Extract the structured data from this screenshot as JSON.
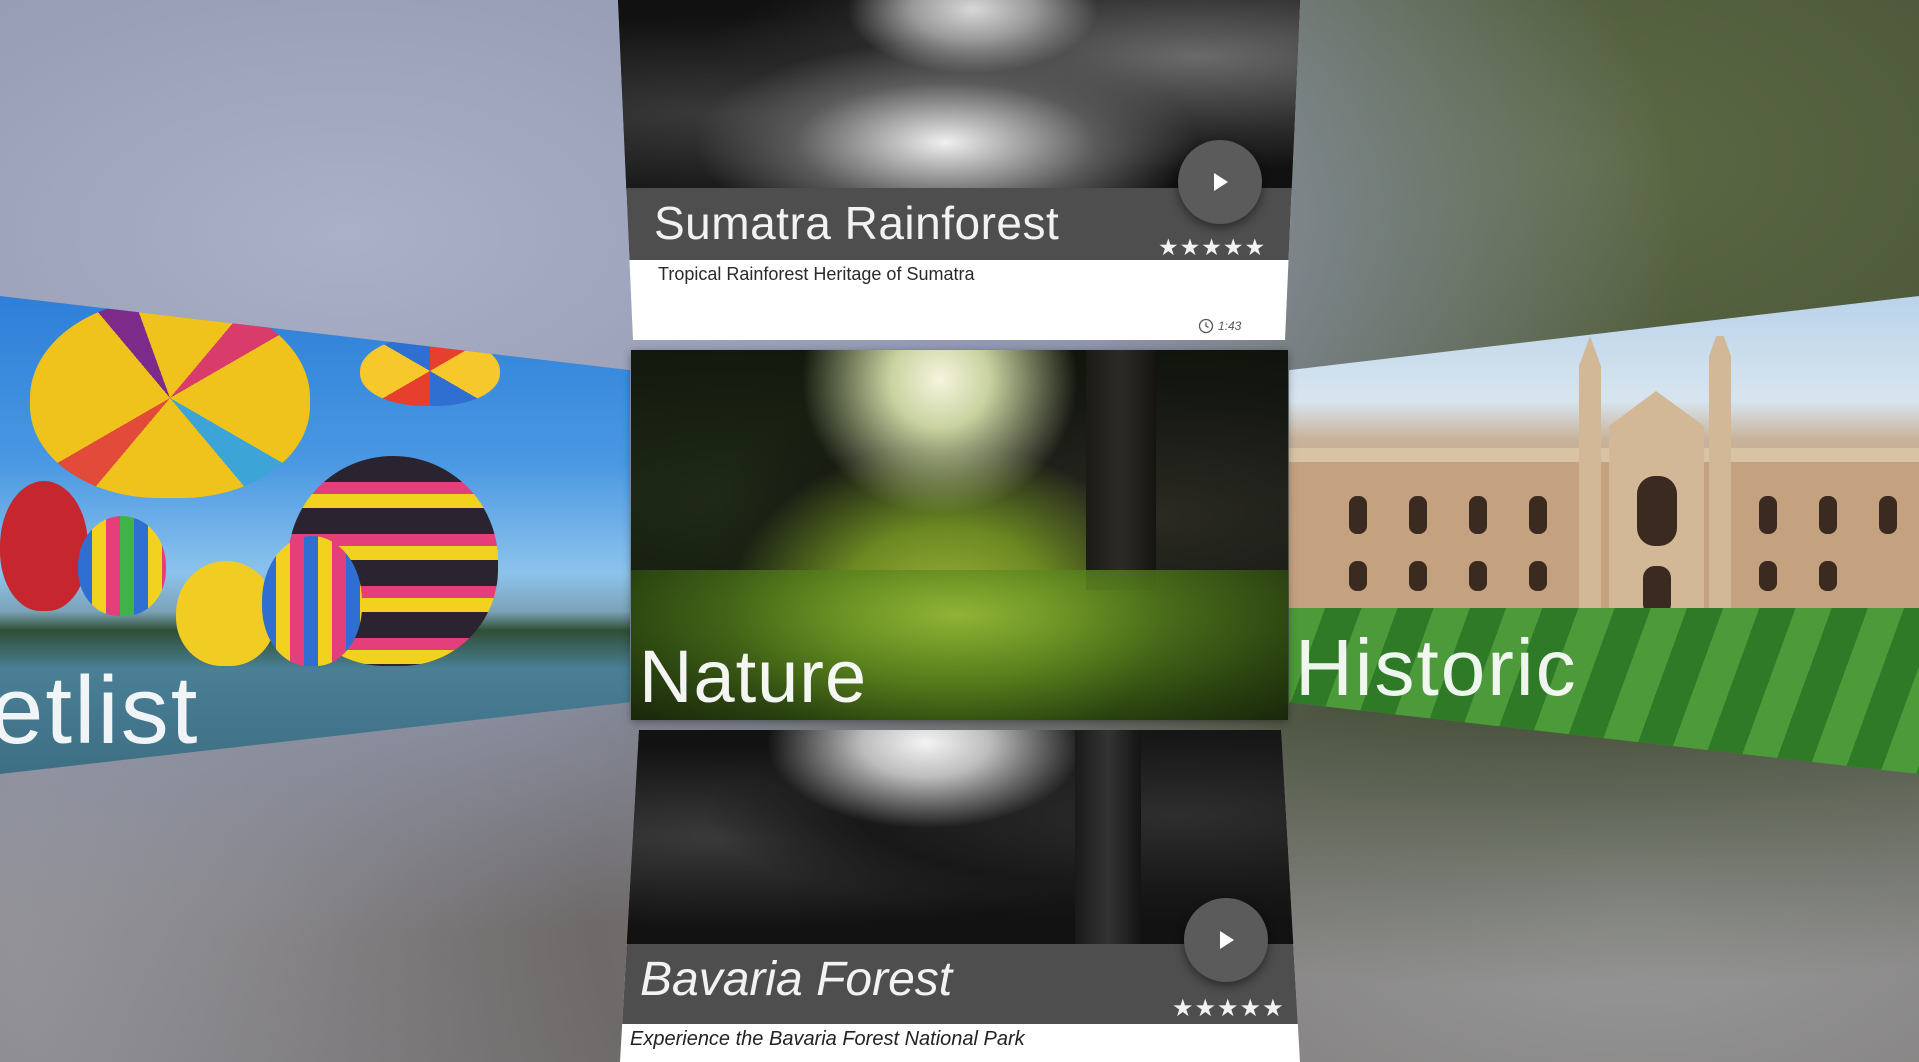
{
  "colors": {
    "card_bar": "#4e4e4e",
    "play_button": "#5b5b5b",
    "text_light": "#f2f2f2",
    "text_dark": "#2a2a2a"
  },
  "cards": {
    "top": {
      "title": "Sumatra Rainforest",
      "subtitle": "Tropical Rainforest Heritage of Sumatra",
      "duration": "1:43",
      "rating": "★★★★★",
      "icons": [
        "play-icon",
        "clock-icon",
        "star-icon"
      ]
    },
    "center": {
      "label": "Nature"
    },
    "left": {
      "label": "etlist"
    },
    "right": {
      "label": "Historic"
    },
    "bottom": {
      "title": "Bavaria Forest",
      "subtitle": "Experience the Bavaria Forest National Park",
      "rating": "★★★★★",
      "icons": [
        "play-icon",
        "star-icon"
      ]
    }
  }
}
